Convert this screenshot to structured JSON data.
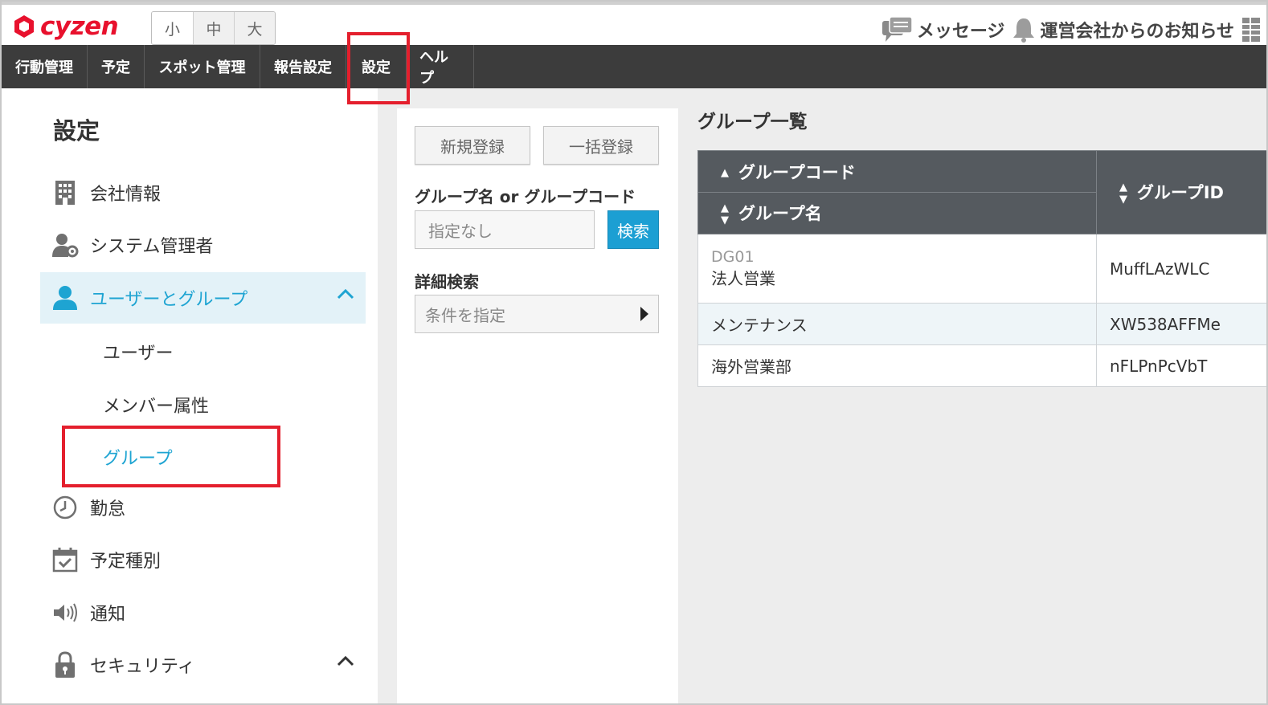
{
  "header": {
    "logo_text": "cyzen",
    "font_sizes": [
      "小",
      "中",
      "大"
    ],
    "messages_label": "メッセージ",
    "notices_label": "運営会社からのお知らせ"
  },
  "nav": {
    "items": [
      "行動管理",
      "予定",
      "スポット管理",
      "報告設定",
      "設定",
      "ヘルプ"
    ]
  },
  "sidebar": {
    "title": "設定",
    "items": [
      {
        "label": "会社情報",
        "icon": "building-icon"
      },
      {
        "label": "システム管理者",
        "icon": "admin-gear-icon"
      },
      {
        "label": "ユーザーとグループ",
        "icon": "user-icon"
      },
      {
        "label": "勤怠",
        "icon": "clock-icon"
      },
      {
        "label": "予定種別",
        "icon": "calendar-check-icon"
      },
      {
        "label": "通知",
        "icon": "speaker-icon"
      },
      {
        "label": "セキュリティ",
        "icon": "lock-icon"
      }
    ],
    "subitems": [
      "ユーザー",
      "メンバー属性",
      "グループ"
    ]
  },
  "search": {
    "new_button": "新規登録",
    "bulk_button": "一括登録",
    "name_code_label": "グループ名 or グループコード",
    "input_placeholder": "指定なし",
    "search_button": "検索",
    "advanced_label": "詳細検索",
    "condition_placeholder": "条件を指定"
  },
  "list": {
    "title": "グループ一覧",
    "headers": {
      "code": "グループコード",
      "name": "グループ名",
      "id": "グループID"
    },
    "rows": [
      {
        "code": "DG01",
        "name": "法人営業",
        "id": "MuffLAzWLC"
      },
      {
        "code": "",
        "name": "メンテナンス",
        "id": "XW538AFFMe"
      },
      {
        "code": "",
        "name": "海外営業部",
        "id": "nFLPnPcVbT"
      }
    ]
  },
  "colors": {
    "brand": "#e8112d",
    "accent": "#1ea4d2",
    "highlight_box": "#e41f2d",
    "nav_bg": "#3c3c3c"
  }
}
